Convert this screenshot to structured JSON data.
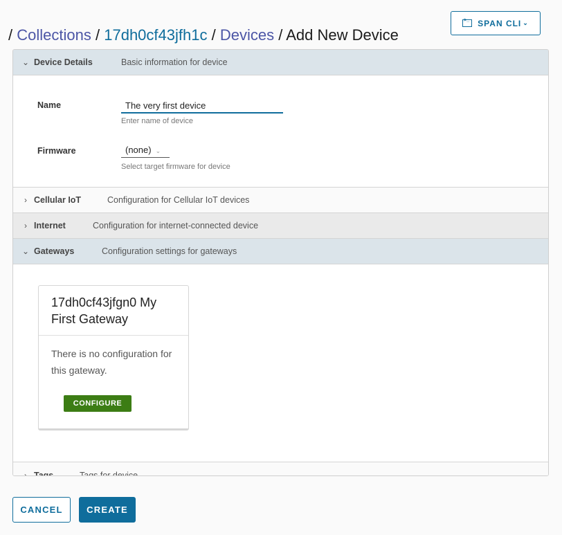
{
  "toolbar": {
    "span_cli_label": "SPAN CLI",
    "span_cli_icon": "terminal-icon",
    "chevron": "chevron-down-icon"
  },
  "breadcrumb": {
    "separator": "/",
    "items": [
      {
        "label": "Collections",
        "link": true
      },
      {
        "label": "17dh0cf43jfh1c",
        "link": true
      },
      {
        "label": "Devices",
        "link": true
      },
      {
        "label": "Add New Device",
        "link": false
      }
    ]
  },
  "sections": {
    "device_details": {
      "title": "Device Details",
      "description": "Basic information for device",
      "expanded": true,
      "name_label": "Name",
      "name_value": "The very first device",
      "name_helper": "Enter name of device",
      "firmware_label": "Firmware",
      "firmware_value": "(none)",
      "firmware_helper": "Select target firmware for device"
    },
    "cellular": {
      "title": "Cellular IoT",
      "description": "Configuration for Cellular IoT devices",
      "expanded": false
    },
    "internet": {
      "title": "Internet",
      "description": "Configuration for internet-connected device",
      "expanded": false
    },
    "gateways": {
      "title": "Gateways",
      "description": "Configuration settings for gateways",
      "expanded": true,
      "card": {
        "title": "17dh0cf43jfgn0 My First Gateway",
        "text": "There is no configuration for this gateway.",
        "button": "CONFIGURE"
      }
    },
    "tags": {
      "title": "Tags",
      "description": "Tags for device",
      "expanded": false
    }
  },
  "actions": {
    "cancel": "CANCEL",
    "create": "CREATE"
  },
  "colors": {
    "primary": "#0f6d9c",
    "link": "#4c56a6",
    "success": "#3c7d14",
    "open_header": "#dbe4ea"
  }
}
